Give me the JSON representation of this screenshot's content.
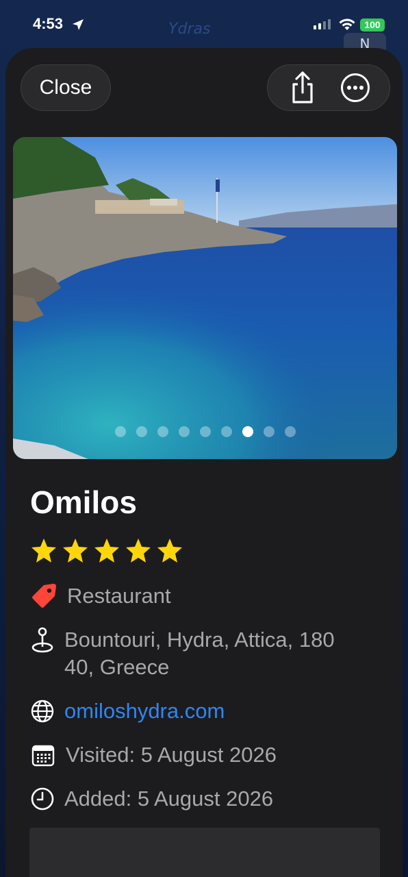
{
  "status_bar": {
    "time": "4:53",
    "battery": "100"
  },
  "map": {
    "label": "Ydras",
    "compass": "N"
  },
  "header": {
    "close_label": "Close",
    "share_icon": "share-icon",
    "more_icon": "ellipsis-circle-icon"
  },
  "photo": {
    "page_count": 9,
    "active_page": 7
  },
  "place": {
    "name": "Omilos",
    "rating": 5,
    "rating_max": 5,
    "category": "Restaurant",
    "address": "Bountouri, Hydra, Attica, 180 40, Greece",
    "website": "omiloshydra.com",
    "visited": "Visited: 5 August 2026",
    "added": "Added: 5 August 2026"
  },
  "colors": {
    "accent_link": "#2f86f2",
    "star": "#ffd60a",
    "tag": "#ff453a",
    "battery": "#34c759"
  }
}
